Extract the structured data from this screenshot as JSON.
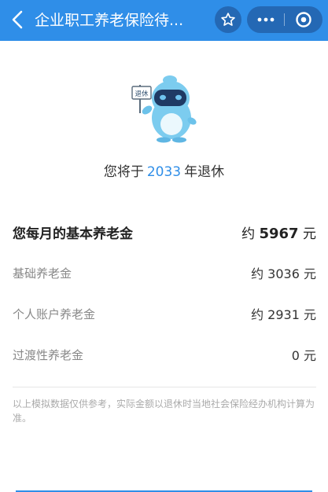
{
  "header": {
    "title": "企业职工养老保险待...",
    "bg_color": "#2f8ee8",
    "icons": {
      "back": "chevron-left-icon",
      "favorite": "star-icon",
      "more": "more-dots-icon",
      "close": "target-close-icon"
    }
  },
  "mascot": {
    "sign_text": "退休"
  },
  "retire": {
    "prefix": "您将于",
    "year": "2033",
    "suffix": "年退休"
  },
  "pension": {
    "total_label": "您每月的基本养老金",
    "total_prefix": "约",
    "total_value": "5967",
    "total_unit": "元",
    "items": [
      {
        "label": "基础养老金",
        "value": "约 3036 元"
      },
      {
        "label": "个人账户养老金",
        "value": "约 2931 元"
      },
      {
        "label": "过渡性养老金",
        "value": "0 元"
      }
    ]
  },
  "disclaimer": "以上模拟数据仅供参考，实际金额以退休时当地社会保险经办机构计算为准。",
  "colors": {
    "accent": "#2f8ee8",
    "capsule": "#2468b4"
  }
}
